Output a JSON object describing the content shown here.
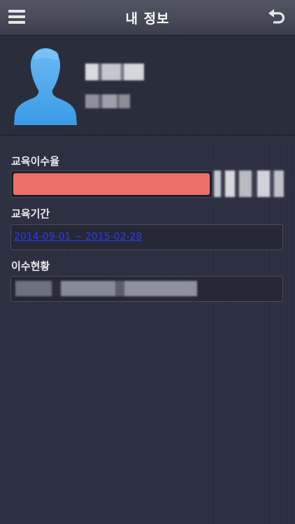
{
  "header": {
    "title": "내 정보",
    "menu_icon": "hamburger-menu-icon",
    "back_icon": "return-arrow-icon"
  },
  "profile": {
    "avatar_icon": "user-silhouette-icon",
    "name": "",
    "subtitle": ""
  },
  "education_rate": {
    "label": "교육이수율",
    "progress_fraction": 0.73,
    "value_text": "",
    "bar_color": "#ee6e6a"
  },
  "education_period": {
    "label": "교육기간",
    "value": "2014-09-01 ~ 2015-02-28",
    "link_color": "#2a3cf2"
  },
  "completion_status": {
    "label": "이수현황",
    "value": ""
  },
  "colors": {
    "background": "#2c2f40",
    "header": "#474a58",
    "avatar_blue": "#4aa7ea"
  }
}
